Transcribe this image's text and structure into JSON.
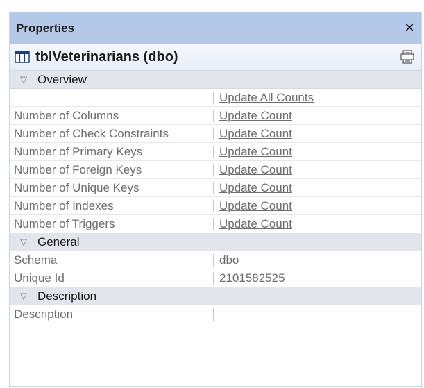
{
  "panel": {
    "title": "Properties",
    "close_glyph": "✕"
  },
  "object": {
    "name": "tblVeterinarians (dbo)",
    "icon": "table-icon",
    "pages_icon": "property-pages-icon"
  },
  "sections": {
    "overview": {
      "label": "Overview",
      "toggle_glyph": "▽",
      "update_all": "Update All Counts",
      "rows": [
        {
          "name": "Number of Columns",
          "value": "Update Count"
        },
        {
          "name": "Number of Check Constraints",
          "value": "Update Count"
        },
        {
          "name": "Number of Primary Keys",
          "value": "Update Count"
        },
        {
          "name": "Number of Foreign Keys",
          "value": "Update Count"
        },
        {
          "name": "Number of Unique Keys",
          "value": "Update Count"
        },
        {
          "name": "Number of Indexes",
          "value": "Update Count"
        },
        {
          "name": "Number of Triggers",
          "value": "Update Count"
        }
      ]
    },
    "general": {
      "label": "General",
      "toggle_glyph": "▽",
      "rows": [
        {
          "name": "Schema",
          "value": "dbo"
        },
        {
          "name": "Unique Id",
          "value": "2101582525"
        }
      ]
    },
    "description": {
      "label": "Description",
      "toggle_glyph": "▽",
      "rows": [
        {
          "name": "Description",
          "value": ""
        }
      ]
    }
  },
  "colors": {
    "titlebar_bg": "#b4c8e7",
    "category_bg": "#e2e6ec",
    "label_text": "#6d6d6d"
  }
}
